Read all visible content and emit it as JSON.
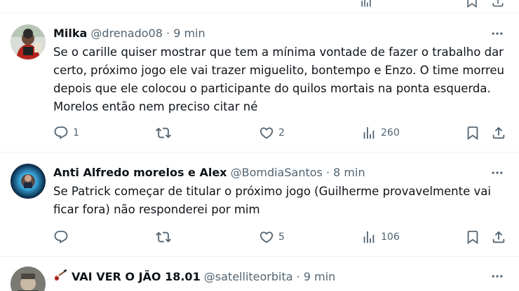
{
  "colors": {
    "text": "#0f1419",
    "secondary": "#536471",
    "divider": "#eff3f4"
  },
  "tweets": [
    {
      "name": "Milka",
      "handle": "@drenado08",
      "dot": "·",
      "time": "9 min",
      "text": "Se o carille quiser mostrar que tem a mínima vontade de fazer o trabalho dar certo, próximo jogo ele vai trazer miguelito, bontempo e Enzo. O time morreu depois que ele colocou o participante do quilos mortais na ponta esquerda. Morelos então nem preciso citar né",
      "replies": "1",
      "retweets": "",
      "likes": "2",
      "views": "260"
    },
    {
      "name": "Anti Alfredo morelos e Alex",
      "handle": "@BomdiaSantos",
      "dot": "·",
      "time": "8 min",
      "text": "Se Patrick começar de titular o próximo jogo (Guilherme provavelmente vai ficar fora) não responderei por mim",
      "replies": "",
      "retweets": "",
      "likes": "5",
      "views": "106"
    },
    {
      "name": "VAI VER O JÃO 18.01",
      "handle": "@satelliteorbita",
      "dot": "·",
      "time": "9 min",
      "name_emoji": "guitar-icon"
    }
  ]
}
